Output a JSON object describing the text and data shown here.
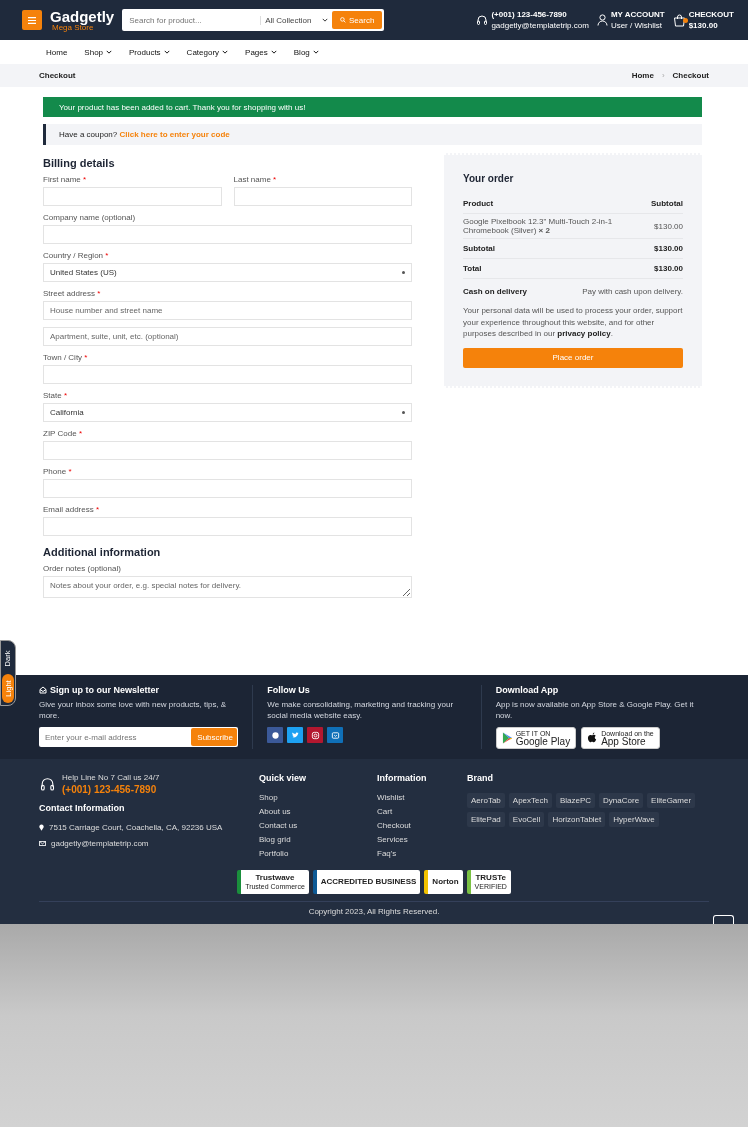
{
  "header": {
    "logo": {
      "name": "Gadgetly",
      "tagline": "Mega Store"
    },
    "search": {
      "placeholder": "Search for product...",
      "collection": "All Collection",
      "button": "Search"
    },
    "contact": {
      "phone": "(+001) 123-456-7890",
      "email": "gadgetly@templatetrip.com"
    },
    "account": {
      "title": "MY ACCOUNT",
      "subtitle": "User / Wishlist"
    },
    "cart": {
      "title": "CHECKOUT",
      "total": "$130.00"
    }
  },
  "nav": [
    {
      "label": "Home",
      "has_menu": false
    },
    {
      "label": "Shop",
      "has_menu": true
    },
    {
      "label": "Products",
      "has_menu": true
    },
    {
      "label": "Category",
      "has_menu": true
    },
    {
      "label": "Pages",
      "has_menu": true
    },
    {
      "label": "Blog",
      "has_menu": true
    }
  ],
  "breadcrumb": {
    "title": "Checkout",
    "separator": "›",
    "trail": [
      "Home",
      "Checkout"
    ]
  },
  "notice": "Your product has been added to cart. Thank you for shopping with us!",
  "coupon": {
    "text": "Have a coupon?",
    "link": "Click here to enter your code"
  },
  "billing": {
    "title": "Billing details",
    "rows": [
      [
        {
          "kind": "text",
          "label": "First name",
          "required_mark": "*"
        },
        {
          "kind": "text",
          "label": "Last name",
          "required_mark": "*"
        }
      ],
      [
        {
          "kind": "text",
          "label": "Company name (optional)"
        }
      ],
      [
        {
          "kind": "select",
          "label": "Country / Region",
          "required_mark": "*",
          "value": "United States (US)"
        }
      ],
      [
        {
          "kind": "text",
          "label": "Street address",
          "required_mark": "*",
          "placeholder": "House number and street name"
        }
      ],
      [
        {
          "kind": "text",
          "placeholder": "Apartment, suite, unit, etc. (optional)"
        }
      ],
      [
        {
          "kind": "text",
          "label": "Town / City",
          "required_mark": "*"
        }
      ],
      [
        {
          "kind": "select",
          "label": "State",
          "required_mark": "*",
          "value": "California"
        }
      ],
      [
        {
          "kind": "text",
          "label": "ZIP Code",
          "required_mark": "*"
        }
      ],
      [
        {
          "kind": "text",
          "label": "Phone",
          "required_mark": "*"
        }
      ],
      [
        {
          "kind": "text",
          "label": "Email address",
          "required_mark": "*"
        }
      ]
    ]
  },
  "additional": {
    "title": "Additional information",
    "label": "Order notes (optional)",
    "placeholder": "Notes about your order, e.g. special notes for delivery."
  },
  "order": {
    "title": "Your order",
    "rows": [
      {
        "kind": "header",
        "left": "Product",
        "right": "Subtotal"
      },
      {
        "kind": "item",
        "left": "Google Pixelbook 12.3\" Multi-Touch 2-in-1 Chromebook (Silver) **× 2**",
        "right": "$130.00"
      },
      {
        "kind": "sum",
        "left": "Subtotal",
        "right": "$130.00"
      },
      {
        "kind": "sum",
        "left": "Total",
        "right": "$130.00"
      },
      {
        "kind": "payment",
        "left": "Cash on delivery",
        "right": "Pay with cash upon delivery."
      }
    ],
    "privacy": {
      "text": "Your personal data will be used to process your order, support your experience throughout this website, and for other purposes described in our",
      "link": "privacy policy",
      "end": "."
    },
    "button": "Place order"
  },
  "theme_toggle": [
    {
      "label": "Dark",
      "selected": false
    },
    {
      "label": "Light",
      "selected": true
    }
  ],
  "newsletter": {
    "title": "Sign up to our Newsletter",
    "text": "Give your inbox some love with new products, tips, & more.",
    "placeholder": "Enter your e-mail address",
    "button": "Subscribe"
  },
  "follow": {
    "title": "Follow Us",
    "text": "We make consolidating, marketing and tracking your social media website easy.",
    "links": [
      {
        "kind": "facebook",
        "color": "#3b5998"
      },
      {
        "kind": "twitter",
        "color": "#1da1f2"
      },
      {
        "kind": "instagram",
        "color": "#b3172f"
      },
      {
        "kind": "message",
        "color": "#0f70b8"
      }
    ]
  },
  "download": {
    "title": "Download App",
    "text": "App is now available on App Store & Google Play. Get it now.",
    "stores": [
      {
        "kind": "play",
        "small": "GET IT ON",
        "big": "Google Play"
      },
      {
        "kind": "apple",
        "small": "Download on the",
        "big": "App Store"
      }
    ]
  },
  "footer": {
    "helpline": {
      "label": "Help Line No 7 Call us 24/7",
      "phone": "(+001) 123-456-7890"
    },
    "contact_title": "Contact Information",
    "address": "7515 Carriage Court, Coachella, CA, 92236 USA",
    "email": "gadgetly@templatetrip.com",
    "columns": [
      {
        "title": "Quick view",
        "links": [
          "Shop",
          "About us",
          "Contact us",
          "Blog grid",
          "Portfolio"
        ]
      },
      {
        "title": "Information",
        "links": [
          "Wishlist",
          "Cart",
          "Checkout",
          "Services",
          "Faq's"
        ]
      }
    ],
    "brand_title": "Brand",
    "brands": [
      "AeroTab",
      "ApexTech",
      "BlazePC",
      "DynaCore",
      "EliteGamer",
      "ElitePad",
      "EvoCell",
      "HorizonTablet",
      "HyperWave"
    ],
    "badges": [
      {
        "label": "Trustwave",
        "sub": "Trusted Commerce",
        "color": "#1a8f3c"
      },
      {
        "label": "ACCREDITED BUSINESS",
        "color": "#0d5a96"
      },
      {
        "label": "Norton",
        "color": "#f2c200"
      },
      {
        "label": "TRUSTe",
        "sub": "VERIFIED",
        "color": "#7ac143"
      }
    ],
    "copyright": "Copyright 2023, All Rights Reserved."
  }
}
